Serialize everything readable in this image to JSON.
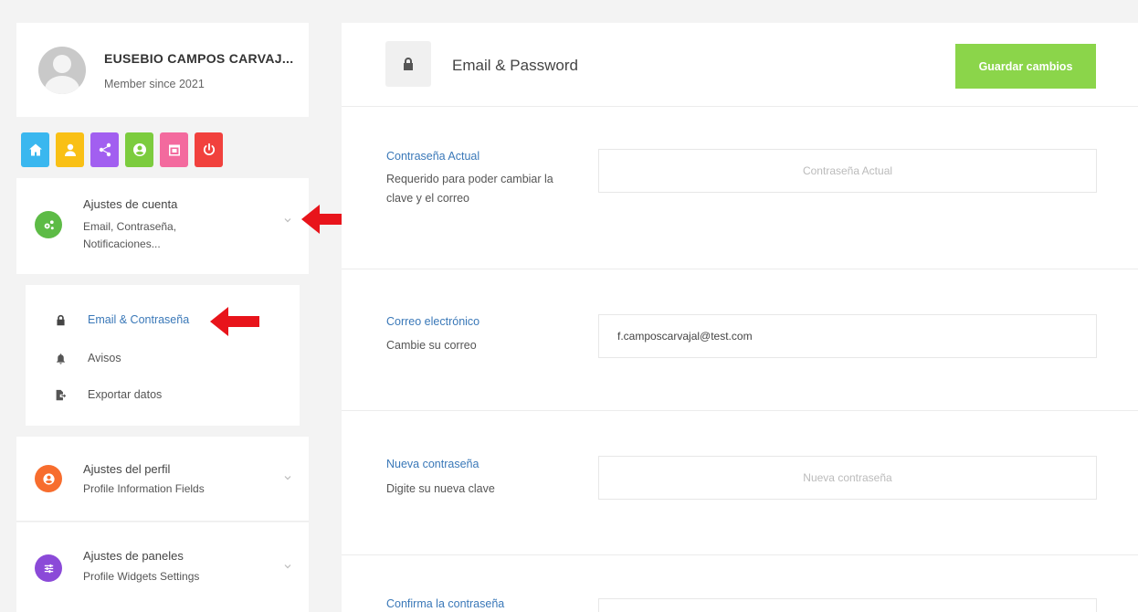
{
  "user": {
    "name": "EUSEBIO CAMPOS CARVAJ...",
    "since": "Member since 2021"
  },
  "quick_links": [
    {
      "icon": "home-icon",
      "color": "#3ab7ef"
    },
    {
      "icon": "user-icon",
      "color": "#f9c015"
    },
    {
      "icon": "share-icon",
      "color": "#a25ff0"
    },
    {
      "icon": "account-circle-icon",
      "color": "#7ccc3e"
    },
    {
      "icon": "calendar-icon",
      "color": "#f36a9e"
    },
    {
      "icon": "power-icon",
      "color": "#f1413d"
    }
  ],
  "sidebar": {
    "account": {
      "title": "Ajustes de cuenta",
      "subtitle": "Email, Contraseña, Notificaciones...",
      "color": "#5dbb46"
    },
    "account_items": [
      {
        "label": "Email & Contraseña",
        "icon": "lock-icon",
        "active": true
      },
      {
        "label": "Avisos",
        "icon": "bell-icon",
        "active": false
      },
      {
        "label": "Exportar datos",
        "icon": "export-file-icon",
        "active": false
      }
    ],
    "profile": {
      "title": "Ajustes del perfil",
      "subtitle": "Profile Information Fields",
      "color": "#f76d2e"
    },
    "panels": {
      "title": "Ajustes de paneles",
      "subtitle": "Profile Widgets Settings",
      "color": "#8b4ad8"
    }
  },
  "main": {
    "title": "Email & Password",
    "save_label": "Guardar cambios",
    "accent": "#8bd54a",
    "link_color": "#3a78b8",
    "rows": [
      {
        "label": "Contraseña Actual",
        "desc": "Requerido para poder cambiar la clave y el correo",
        "value": "",
        "placeholder": "Contraseña Actual"
      },
      {
        "label": "Correo electrónico",
        "desc": "Cambie su correo",
        "value": "f.camposcarvajal@test.com",
        "placeholder": ""
      },
      {
        "label": "Nueva contraseña",
        "desc": "Digite su nueva clave",
        "value": "",
        "placeholder": "Nueva contraseña"
      },
      {
        "label": "Confirma la contraseña",
        "desc": "",
        "value": "",
        "placeholder": ""
      }
    ]
  }
}
